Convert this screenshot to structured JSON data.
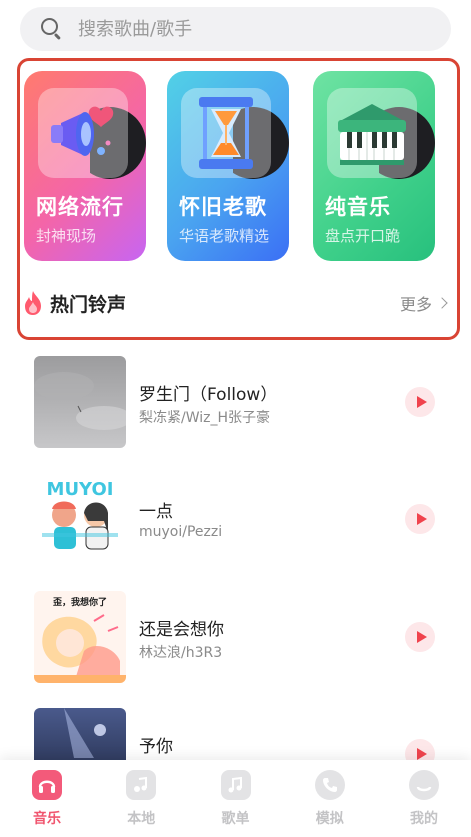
{
  "search": {
    "placeholder": "搜索歌曲/歌手"
  },
  "categories": [
    {
      "title": "网络流行",
      "subtitle": "封神现场",
      "icon": "megaphone-icon"
    },
    {
      "title": "怀旧老歌",
      "subtitle": "华语老歌精选",
      "icon": "hourglass-icon"
    },
    {
      "title": "纯音乐",
      "subtitle": "盘点开口跪",
      "icon": "piano-icon"
    }
  ],
  "hot": {
    "title": "热门铃声",
    "more": "更多"
  },
  "songs": [
    {
      "name": "罗生门（Follow）",
      "artist": "梨冻紧/Wiz_H张子豪"
    },
    {
      "name": "一点",
      "artist": "muyoi/Pezzi"
    },
    {
      "name": "还是会想你",
      "artist": "林达浪/h3R3"
    },
    {
      "name": "予你",
      "artist": ""
    }
  ],
  "cover_texts": {
    "song2_banner": "MUYOI",
    "song3_caption": "歪，我想你了"
  },
  "nav": [
    {
      "label": "音乐",
      "active": true
    },
    {
      "label": "本地",
      "active": false
    },
    {
      "label": "歌单",
      "active": false
    },
    {
      "label": "模拟",
      "active": false
    },
    {
      "label": "我的",
      "active": false
    }
  ],
  "colors": {
    "accent": "#f0566f",
    "highlight_border": "#d94434",
    "play": "#f0434d"
  }
}
